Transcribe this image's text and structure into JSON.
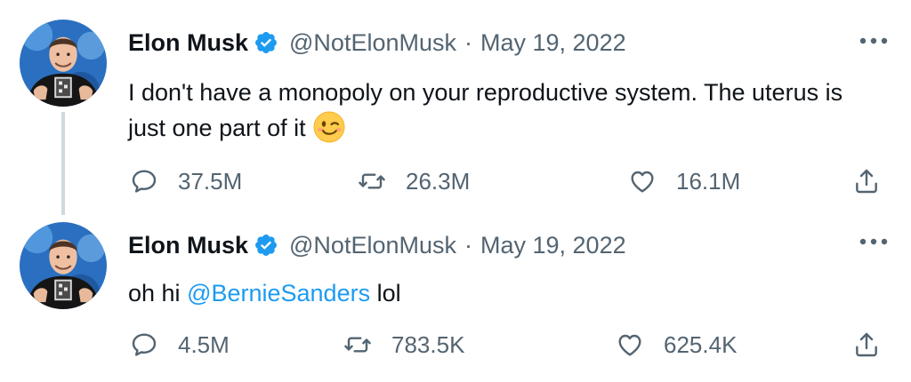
{
  "tweets": [
    {
      "name": "Elon Musk",
      "handle": "@NotElonMusk",
      "separator": "·",
      "date": "May 19, 2022",
      "text": "I don't have a monopoly on your reproductive system. The uterus is just one part of it",
      "emoji": "winking-face",
      "stats": {
        "replies": "37.5M",
        "retweets": "26.3M",
        "likes": "16.1M"
      }
    },
    {
      "name": "Elon Musk",
      "handle": "@NotElonMusk",
      "separator": "·",
      "date": "May 19, 2022",
      "text_before": "oh hi ",
      "mention": "@BernieSanders",
      "text_after": " lol",
      "stats": {
        "replies": "4.5M",
        "retweets": "783.5K",
        "likes": "625.4K"
      }
    }
  ],
  "colors": {
    "accent": "#1d9bf0",
    "text_primary": "#0f1419",
    "text_secondary": "#536471",
    "thread_line": "#cfd9de"
  },
  "icons": [
    "verified-badge-icon",
    "more-icon",
    "reply-icon",
    "retweet-icon",
    "like-icon",
    "share-icon"
  ]
}
